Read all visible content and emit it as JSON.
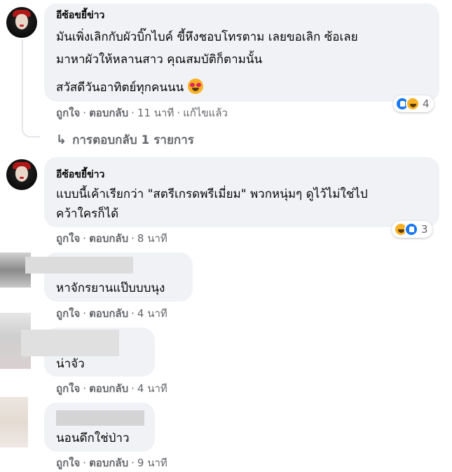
{
  "comments": [
    {
      "author": "อีซ้อขยี้ข่าว",
      "lines": [
        "มันเพิ่งเลิกกับผัวบิ๊กไบค์ ขี้หึงชอบโทรตาม เลยขอเลิก ซ้อเลย",
        "มาหาผัวให้หลานสาว คุณสมบัติก็ตามนั้น",
        "สวัสดีวันอาทิตย์ทุกคนนน"
      ],
      "emoji": "heart-eyes-emoji",
      "actions": {
        "like": "ถูกใจ",
        "reply": "ตอบกลับ",
        "time": "11 นาที",
        "edited": "แก้ไขแล้ว"
      },
      "reaction_count": "4",
      "reactions": [
        "like-reaction-icon",
        "haha-reaction-icon"
      ]
    },
    {
      "author": "อีซ้อขยี้ข่าว",
      "lines": [
        "แบบนี้เค้าเรียกว่า \"สตรีเกรดพรีเมี่ยม\" พวกหนุ่มๆ ดูไว้ไม่ใช่ไป",
        "คว้าใครก็ได้"
      ],
      "actions": {
        "like": "ถูกใจ",
        "reply": "ตอบกลับ",
        "time": "8 นาที"
      },
      "reaction_count": "3",
      "reactions": [
        "haha-reaction-icon",
        "like-reaction-icon"
      ]
    },
    {
      "lines": [
        "หาจักรยานแป๊บบบนุง"
      ],
      "actions": {
        "like": "ถูกใจ",
        "reply": "ตอบกลับ",
        "time": "4 นาที"
      }
    },
    {
      "lines": [
        "น่าจัว"
      ],
      "actions": {
        "like": "ถูกใจ",
        "reply": "ตอบกลับ",
        "time": "4 นาที"
      }
    },
    {
      "lines": [
        "นอนดึกใช่ป่าว"
      ],
      "actions": {
        "like": "ถูกใจ",
        "reply": "ตอบกลับ",
        "time": "9 นาที"
      }
    }
  ],
  "replies_link": "การตอบกลับ 1 รายการ",
  "colors": {
    "bubble": "#f0f2f5",
    "meta": "#65676b",
    "text": "#050505",
    "like": "#1877f2",
    "haha": "#f7b125"
  }
}
